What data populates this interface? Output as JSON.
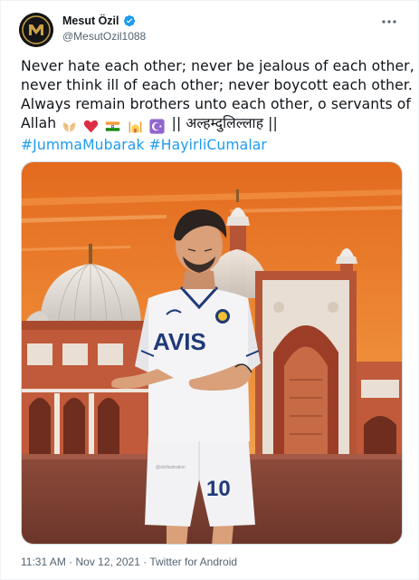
{
  "author": {
    "display_name": "Mesut Özil",
    "handle": "@MesutOzil1088",
    "verified": true
  },
  "tweet": {
    "line1": "Never hate each other; never be jealous of each other,",
    "line2": "never think ill of each other; never boycott each other.",
    "line3": "Always remain brothers unto each other, o servants of",
    "line4_start": "Allah",
    "line4_end": "|| अल्हम्दुलिल्लाह ||",
    "hashtag1": "#JummaMubarak",
    "hashtag2": "#HayirliCumalar",
    "emojis": [
      "palms-up-together-icon",
      "red-heart-icon",
      "india-flag-icon",
      "mosque-icon",
      "star-and-crescent-icon"
    ]
  },
  "media": {
    "jersey_sponsor": "AVIS",
    "jersey_number": "10",
    "artist_tag": "@dzillustration"
  },
  "meta": {
    "time": "11:31 AM",
    "separator1": " · ",
    "date": "Nov 12, 2021",
    "separator2": " · ",
    "client": "Twitter for Android"
  },
  "colors": {
    "link": "#1d9bf0",
    "secondary_text": "#536471",
    "sky_orange": "#e8782a"
  }
}
